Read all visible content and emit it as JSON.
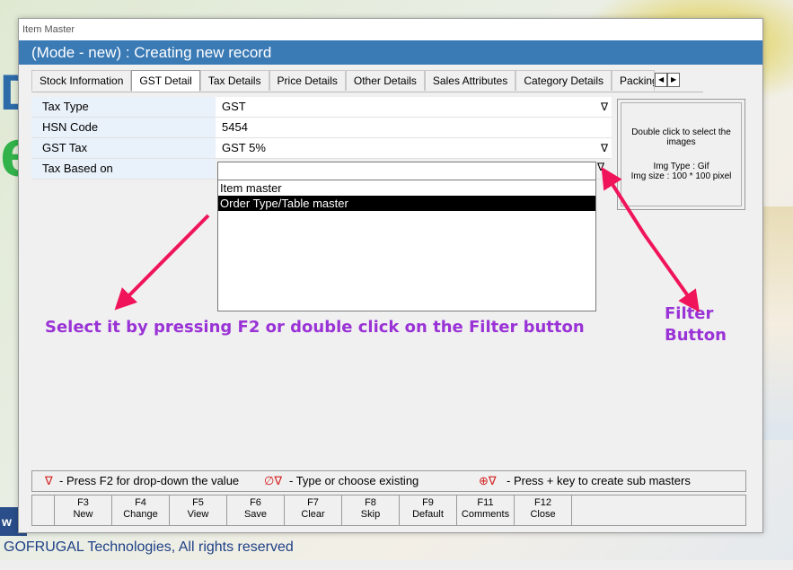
{
  "background": {
    "letter_top": "D",
    "letter_green": "e",
    "strip_text": "w",
    "footer": "GOFRUGAL Technologies, All rights reserved"
  },
  "window": {
    "title": "Item Master",
    "mode_text": "(Mode - new) : Creating new record"
  },
  "tabs": [
    {
      "label": "Stock Information",
      "active": false
    },
    {
      "label": "GST Detail",
      "active": true
    },
    {
      "label": "Tax Details",
      "active": false
    },
    {
      "label": "Price Details",
      "active": false
    },
    {
      "label": "Other Details",
      "active": false
    },
    {
      "label": "Sales Attributes",
      "active": false
    },
    {
      "label": "Category Details",
      "active": false
    },
    {
      "label": "Packing",
      "active": false
    }
  ],
  "tab_scroll": {
    "left": "◀",
    "right": "▶"
  },
  "fields": [
    {
      "label": "Tax Type",
      "value": "GST",
      "dropdown": true
    },
    {
      "label": "HSN Code",
      "value": "5454",
      "dropdown": false
    },
    {
      "label": "GST Tax",
      "value": "GST 5%",
      "dropdown": true
    },
    {
      "label": "Tax Based on",
      "value": "",
      "dropdown": true
    }
  ],
  "dropdown_icon": "∇",
  "dropdown_options": [
    {
      "label": "Item master",
      "selected": false
    },
    {
      "label": "Order Type/Table master",
      "selected": true
    }
  ],
  "image_panel": {
    "hint": "Double click to select the images",
    "img_type": "Img Type : Gif",
    "img_size": "Img size : 100 * 100 pixel"
  },
  "annotations": {
    "select_text": "Select it by pressing F2 or double click on the Filter button",
    "filter_line1": "Filter",
    "filter_line2": "Button",
    "arrow_color": "#f0145a"
  },
  "legend": {
    "item1_icon": "∇",
    "item1_text": "- Press F2 for drop-down the value",
    "item2_icon": "∅∇",
    "item2_text": "- Type or choose existing",
    "item3_icon": "⊕∇",
    "item3_text": "- Press + key to create sub masters"
  },
  "fkeys": [
    {
      "key": "F3",
      "label": "New"
    },
    {
      "key": "F4",
      "label": "Change"
    },
    {
      "key": "F5",
      "label": "View"
    },
    {
      "key": "F6",
      "label": "Save"
    },
    {
      "key": "F7",
      "label": "Clear"
    },
    {
      "key": "F8",
      "label": "Skip"
    },
    {
      "key": "F9",
      "label": "Default"
    },
    {
      "key": "F11",
      "label": "Comments"
    },
    {
      "key": "F12",
      "label": "Close"
    }
  ],
  "colors": {
    "mode_bar": "#3a7ab5",
    "label_bg": "#e9f1fa",
    "annotation_text": "#9a33d6",
    "legend_icon": "#d42020"
  }
}
